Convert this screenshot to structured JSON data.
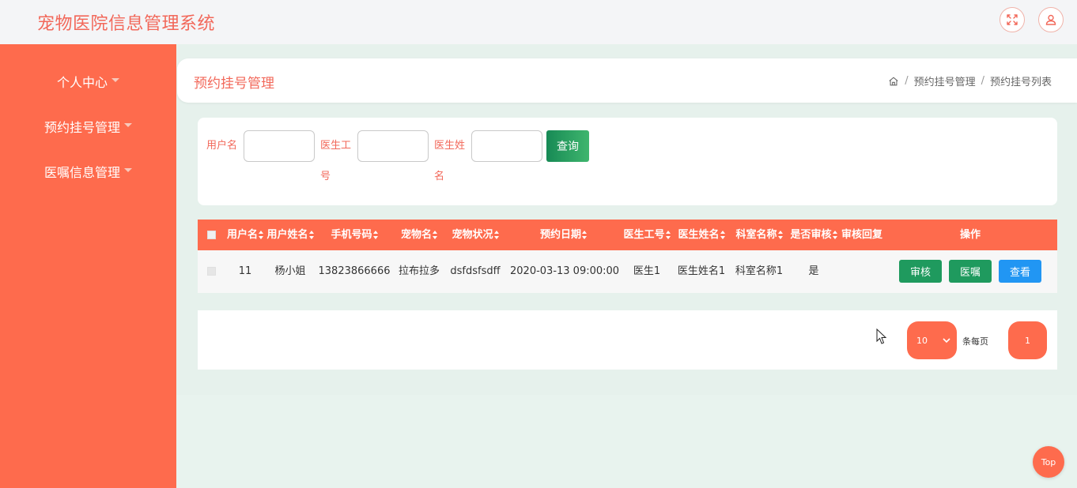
{
  "app": {
    "title": "宠物医院信息管理系统"
  },
  "icons": {
    "fullscreen": "expand-arrows-icon",
    "user": "user-avatar-icon",
    "home": "home-icon",
    "dropdown": "chevron-down-icon",
    "cursor": "mouse-pointer-icon"
  },
  "colors": {
    "primary": "#fe6b4d",
    "title_red": "#f2685a",
    "green": "#1f9a5e",
    "blue": "#2196f3",
    "content_bg": "#e6f1ec"
  },
  "sidebar": {
    "items": [
      {
        "label": "个人中心"
      },
      {
        "label": "预约挂号管理"
      },
      {
        "label": "医嘱信息管理"
      }
    ]
  },
  "page": {
    "title": "预约挂号管理",
    "breadcrumb": [
      "预约挂号管理",
      "预约挂号列表"
    ],
    "breadcrumb_sep": "/"
  },
  "search": {
    "fields": [
      {
        "label": "用户名",
        "value": ""
      },
      {
        "label": "医生工号",
        "value": ""
      },
      {
        "label": "医生姓名",
        "value": ""
      }
    ],
    "query_label": "查询"
  },
  "table": {
    "columns": [
      "用户名",
      "用户姓名",
      "手机号码",
      "宠物名",
      "宠物状况",
      "预约日期",
      "医生工号",
      "医生姓名",
      "科室名称",
      "是否审核",
      "审核回复",
      "操作"
    ],
    "rows": [
      {
        "cells": [
          "11",
          "杨小姐",
          "13823866666",
          "拉布拉多",
          "dsfdsfsdff",
          "2020-03-13 09:00:00",
          "医生1",
          "医生姓名1",
          "科室名称1",
          "是",
          ""
        ]
      }
    ],
    "actions": [
      "审核",
      "医嘱",
      "查看"
    ]
  },
  "pagination": {
    "page_size": "10",
    "per_page_label": "条每页",
    "current_page": "1"
  },
  "back_to_top": "Top"
}
